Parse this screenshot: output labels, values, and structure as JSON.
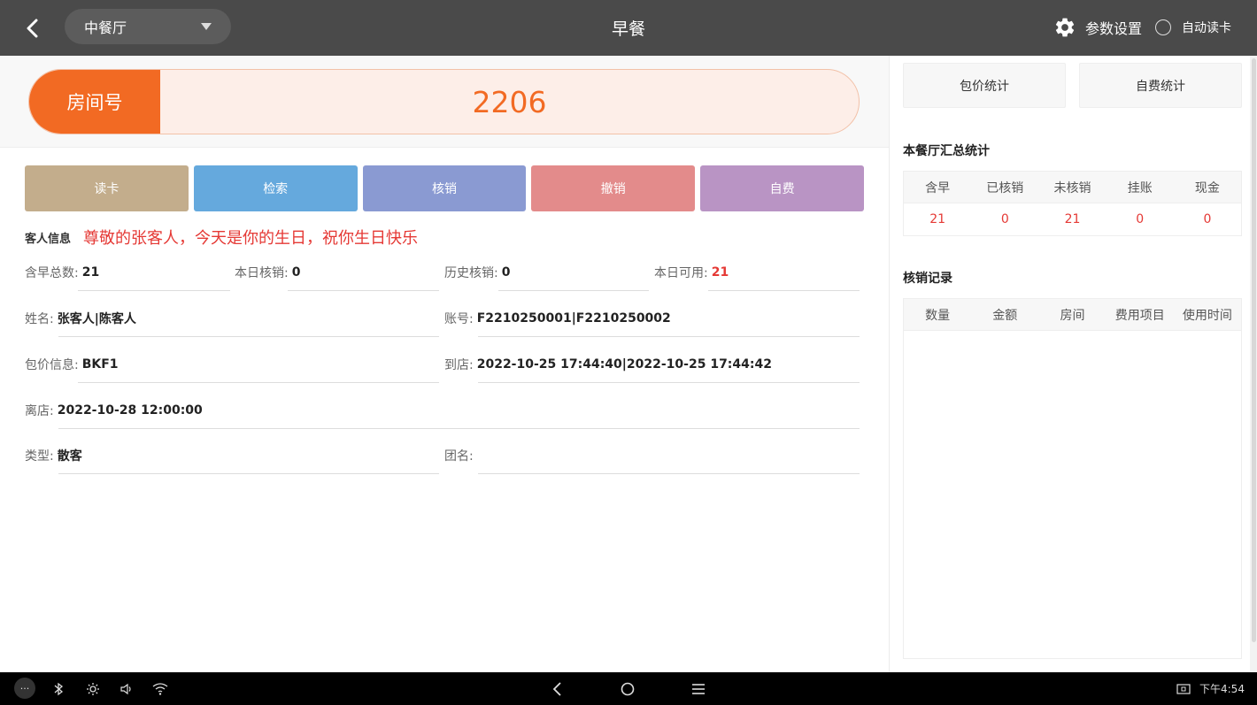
{
  "header": {
    "venue": "中餐厅",
    "title": "早餐",
    "settings_label": "参数设置",
    "auto_read_label": "自动读卡"
  },
  "room": {
    "label": "房间号",
    "value": "2206"
  },
  "actions": [
    {
      "label": "读卡",
      "color": "#c3ad8c"
    },
    {
      "label": "检索",
      "color": "#65a9dd"
    },
    {
      "label": "核销",
      "color": "#8a9ad2"
    },
    {
      "label": "撤销",
      "color": "#e38b8b"
    },
    {
      "label": "自费",
      "color": "#b994c4"
    }
  ],
  "guest": {
    "section_label": "客人信息",
    "greeting": "尊敬的张客人，今天是你的生日，祝你生日快乐",
    "total_breakfast": {
      "label": "含早总数:",
      "value": "21"
    },
    "today_redeemed": {
      "label": "本日核销:",
      "value": "0"
    },
    "history_redeemed": {
      "label": "历史核销:",
      "value": "0"
    },
    "today_available": {
      "label": "本日可用:",
      "value": "21"
    },
    "name": {
      "label": "姓名:",
      "value": "张客人|陈客人"
    },
    "account": {
      "label": "账号:",
      "value": "F2210250001|F2210250002"
    },
    "package": {
      "label": "包价信息:",
      "value": "BKF1"
    },
    "arrival": {
      "label": "到店:",
      "value": "2022-10-25 17:44:40|2022-10-25 17:44:42"
    },
    "departure": {
      "label": "离店:",
      "value": "2022-10-28 12:00:00"
    },
    "type": {
      "label": "类型:",
      "value": "散客"
    },
    "group": {
      "label": "团名:",
      "value": ""
    }
  },
  "right": {
    "package_stats_btn": "包价统计",
    "self_pay_stats_btn": "自费统计",
    "summary_title": "本餐厅汇总统计",
    "summary_headers": [
      "含早",
      "已核销",
      "未核销",
      "挂账",
      "现金"
    ],
    "summary_values": [
      "21",
      "0",
      "21",
      "0",
      "0"
    ],
    "records_title": "核销记录",
    "records_headers": [
      "数量",
      "金额",
      "房间",
      "费用项目",
      "使用时间"
    ]
  },
  "system": {
    "more": "···",
    "time": "下午4:54"
  },
  "colors": {
    "accent": "#f26a23",
    "red": "#e53935",
    "topbar": "#4a4a4a"
  }
}
